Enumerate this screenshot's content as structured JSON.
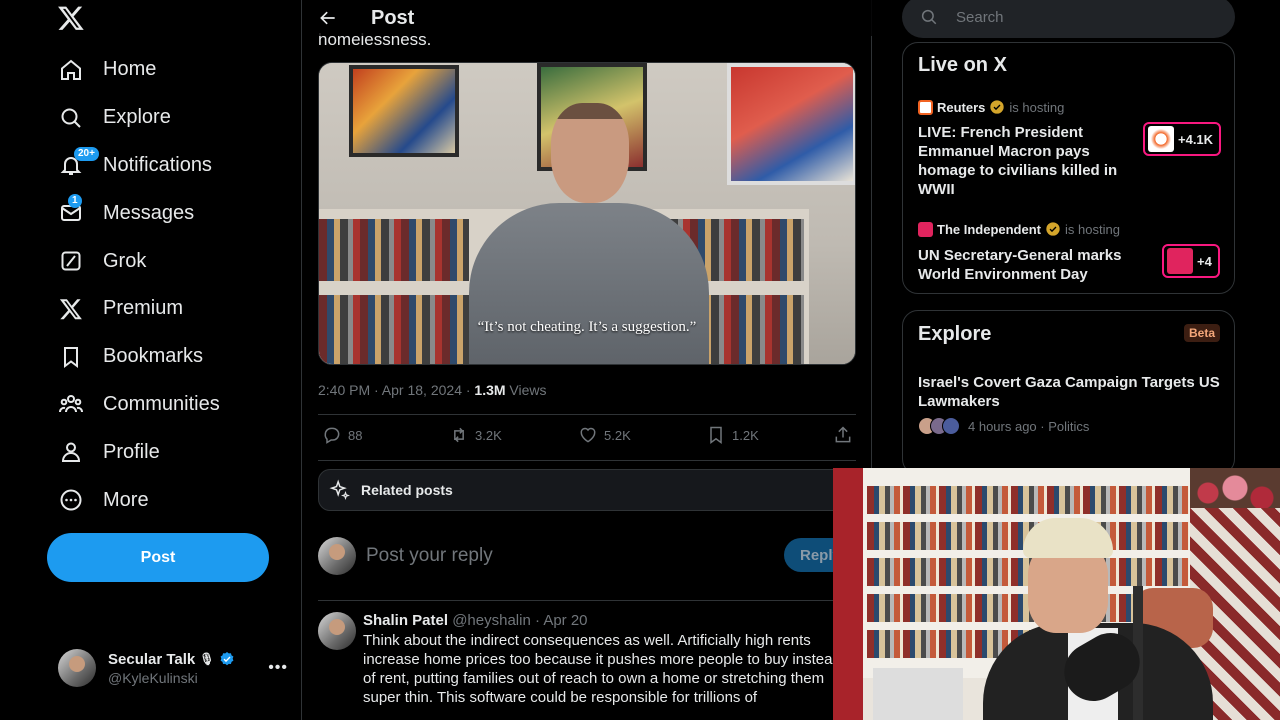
{
  "sidebar": {
    "items": [
      {
        "label": "Home",
        "icon": "home-icon"
      },
      {
        "label": "Explore",
        "icon": "search-icon"
      },
      {
        "label": "Notifications",
        "icon": "bell-icon",
        "badge": "20+"
      },
      {
        "label": "Messages",
        "icon": "envelope-icon",
        "badge": "1"
      },
      {
        "label": "Grok",
        "icon": "grok-icon"
      },
      {
        "label": "Premium",
        "icon": "x-logo-icon"
      },
      {
        "label": "Bookmarks",
        "icon": "bookmark-icon"
      },
      {
        "label": "Communities",
        "icon": "people-icon"
      },
      {
        "label": "Profile",
        "icon": "person-icon"
      },
      {
        "label": "More",
        "icon": "more-circle-icon"
      }
    ],
    "post_label": "Post",
    "account": {
      "name": "Secular Talk",
      "handle": "@KyleKulinski"
    }
  },
  "main": {
    "header_title": "Post",
    "truncated_text": "homelessness.",
    "video_caption": "“It’s not cheating. It’s a suggestion.”",
    "timestamp": "2:40 PM · Apr 18, 2024 · ",
    "views_count": "1.3M",
    "views_label": " Views",
    "actions": {
      "replies": "88",
      "reposts": "3.2K",
      "likes": "5.2K",
      "bookmarks": "1.2K"
    },
    "related_label": "Related posts",
    "reply_placeholder": "Post your reply",
    "reply_button": "Reply",
    "comment": {
      "name": "Shalin Patel",
      "handle": "@heyshalin",
      "date": "Apr 20",
      "text": "Think about the indirect consequences as well. Artificially high rents increase home prices too because it pushes more people to buy instead of rent, putting families out of reach to own a home or stretching them super thin. This software could be responsible for trillions of"
    }
  },
  "right": {
    "search_placeholder": "Search",
    "live": {
      "heading": "Live on X",
      "items": [
        {
          "host": "Reuters",
          "hosting": "is hosting",
          "title": "LIVE: French President Emmanuel Macron pays homage to civilians killed in WWII",
          "count": "+4.1K"
        },
        {
          "host": "The Independent",
          "hosting": "is hosting",
          "title": "UN Secretary-General marks World Environment Day",
          "count": "+4"
        }
      ]
    },
    "explore": {
      "heading": "Explore",
      "badge": "Beta",
      "title": "Israel's Covert Gaza Campaign Targets US Lawmakers",
      "meta": "4 hours ago · Politics"
    }
  },
  "colors": {
    "accent": "#1d9bf0",
    "background": "#000000",
    "muted": "#71767b",
    "live_border": "#f91880"
  }
}
